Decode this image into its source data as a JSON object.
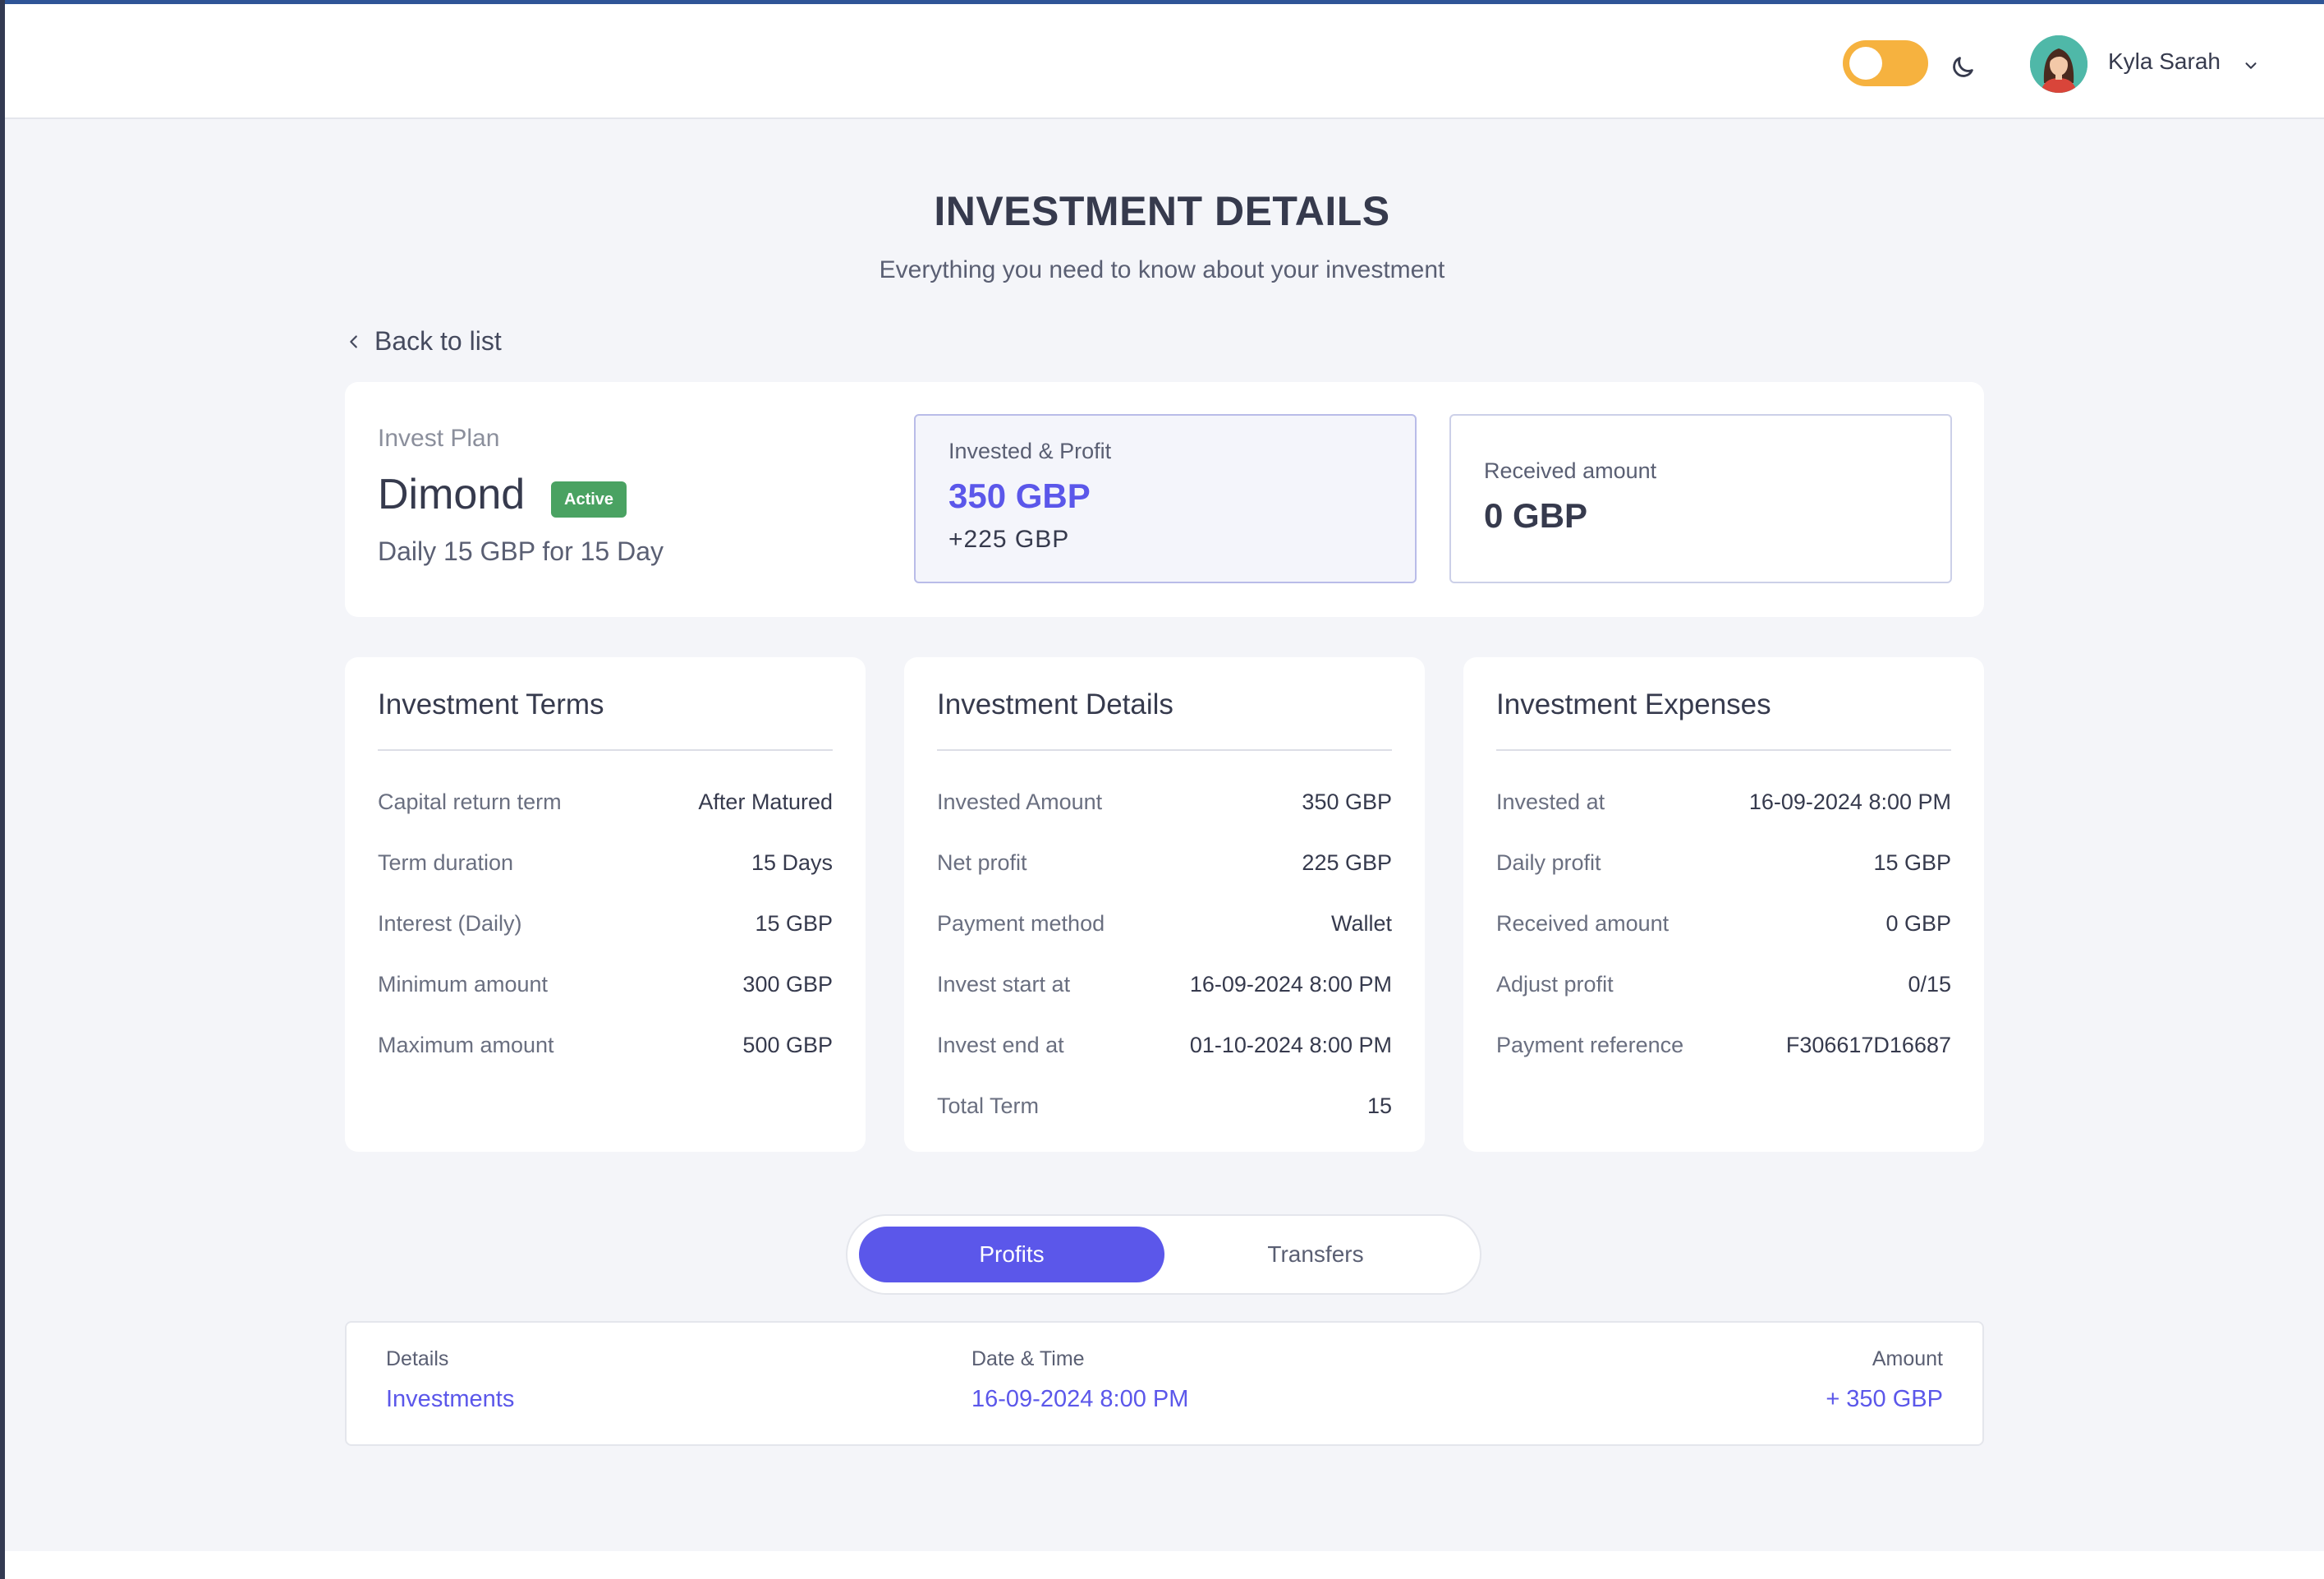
{
  "header": {
    "theme_toggle": {
      "state": "on",
      "color": "#f6b23f"
    },
    "moon_icon": "moon-icon",
    "user": {
      "name": "Kyla Sarah",
      "avatar_icon": "user-avatar"
    }
  },
  "page": {
    "title": "INVESTMENT DETAILS",
    "subtitle": "Everything you need to know about your investment",
    "back_label": "Back to list"
  },
  "plan": {
    "label": "Invest Plan",
    "name": "Dimond",
    "status": "Active",
    "status_color": "#4aa262",
    "description": "Daily 15 GBP for 15 Day",
    "invested_profit": {
      "label": "Invested & Profit",
      "value": "350 GBP",
      "extra": "+225 GBP"
    },
    "received": {
      "label": "Received amount",
      "value": "0 GBP"
    }
  },
  "cards": [
    {
      "title": "Investment Terms",
      "rows": [
        {
          "k": "Capital return term",
          "v": "After Matured"
        },
        {
          "k": "Term duration",
          "v": "15 Days"
        },
        {
          "k": "Interest (Daily)",
          "v": "15 GBP"
        },
        {
          "k": "Minimum amount",
          "v": "300 GBP"
        },
        {
          "k": "Maximum amount",
          "v": "500 GBP"
        }
      ]
    },
    {
      "title": "Investment Details",
      "rows": [
        {
          "k": "Invested Amount",
          "v": "350 GBP"
        },
        {
          "k": "Net profit",
          "v": "225 GBP"
        },
        {
          "k": "Payment method",
          "v": "Wallet"
        },
        {
          "k": "Invest start at",
          "v": "16-09-2024 8:00 PM"
        },
        {
          "k": "Invest end at",
          "v": "01-10-2024 8:00 PM"
        },
        {
          "k": "Total Term",
          "v": "15"
        }
      ]
    },
    {
      "title": "Investment Expenses",
      "rows": [
        {
          "k": "Invested at",
          "v": "16-09-2024 8:00 PM"
        },
        {
          "k": "Daily profit",
          "v": "15 GBP"
        },
        {
          "k": "Received amount",
          "v": "0 GBP"
        },
        {
          "k": "Adjust profit",
          "v": "0/15"
        },
        {
          "k": "Payment reference",
          "v": "F306617D16687"
        }
      ]
    }
  ],
  "tabs": {
    "active": "Profits",
    "inactive": "Transfers",
    "accent": "#5b57ea"
  },
  "transaction": {
    "headers": {
      "details": "Details",
      "datetime": "Date & Time",
      "amount": "Amount"
    },
    "row": {
      "details": "Investments",
      "datetime": "16-09-2024 8:00 PM",
      "amount": "+ 350 GBP"
    }
  }
}
